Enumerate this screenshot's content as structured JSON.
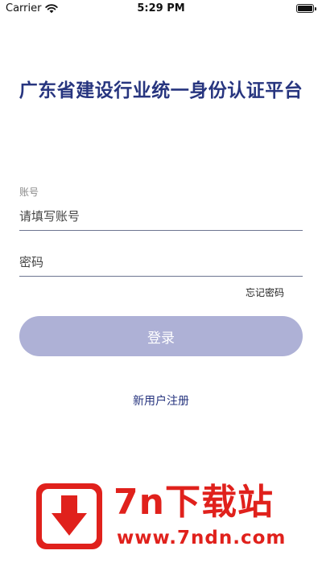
{
  "status_bar": {
    "carrier": "Carrier",
    "time": "5:29 PM"
  },
  "app": {
    "title": "广东省建设行业统一身份认证平台"
  },
  "login_form": {
    "account_caption": "账号",
    "account_placeholder": "请填写账号",
    "account_value": "",
    "password_placeholder": "密码",
    "password_value": "",
    "forgot_password": "忘记密码",
    "login_label": "登录",
    "register_label": "新用户注册"
  },
  "colors": {
    "title": "#27357f",
    "button_bg": "#aeb1d6",
    "underline": "#6d7590",
    "watermark": "#e0211c"
  },
  "watermark": {
    "logo_icon": "download-arrow-icon",
    "name": "7n下载站",
    "url": "www.7ndn.com"
  }
}
